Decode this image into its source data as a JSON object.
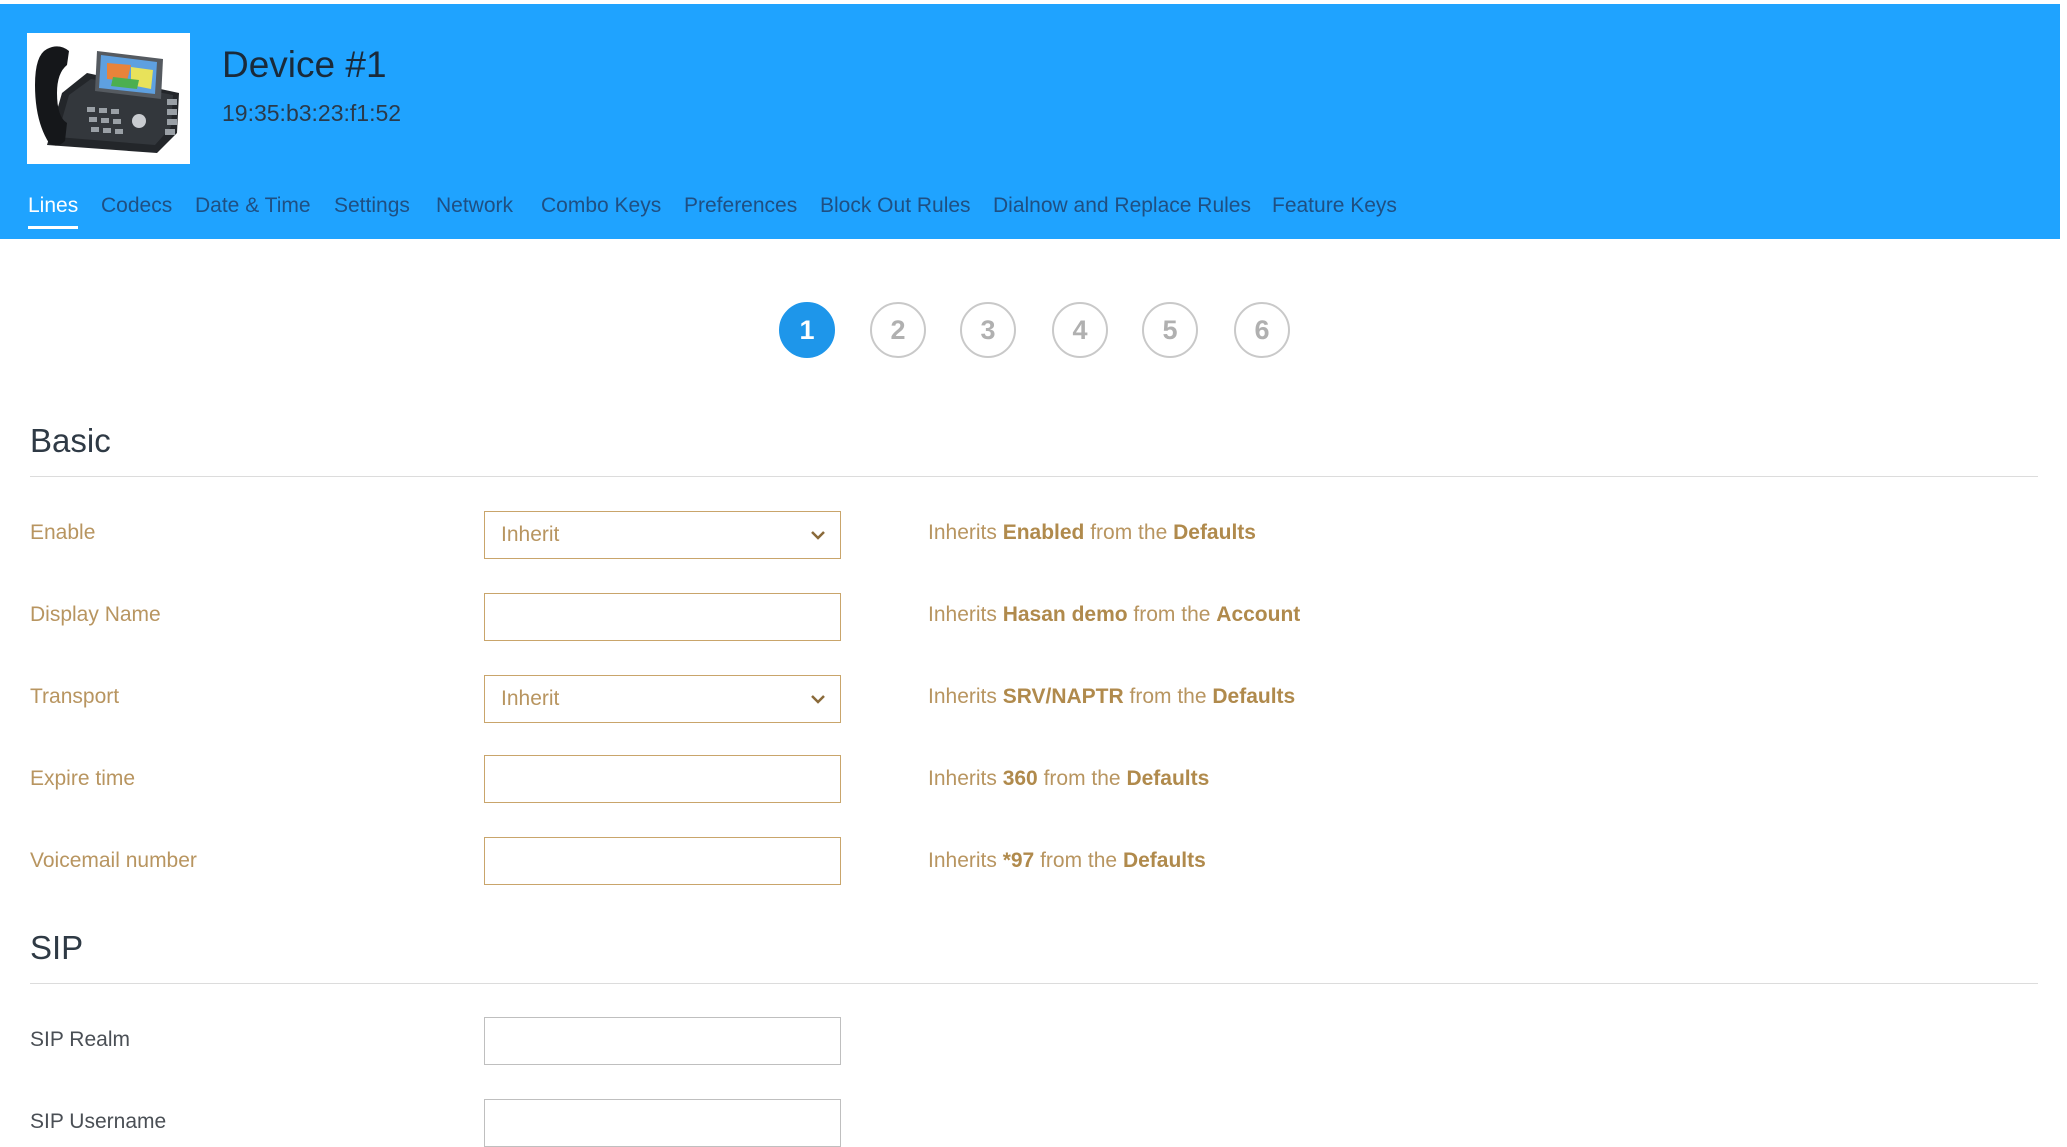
{
  "header": {
    "title": "Device #1",
    "mac": "19:35:b3:23:f1:52",
    "image_icon": "desk-phone-image"
  },
  "tabs": [
    {
      "label": "Lines",
      "active": true
    },
    {
      "label": "Codecs"
    },
    {
      "label": "Date & Time"
    },
    {
      "label": "Settings"
    },
    {
      "label": "Network"
    },
    {
      "label": "Combo Keys"
    },
    {
      "label": "Preferences"
    },
    {
      "label": "Block Out Rules"
    },
    {
      "label": "Dialnow and Replace Rules"
    },
    {
      "label": "Feature Keys"
    }
  ],
  "line_steps": [
    {
      "label": "1",
      "active": true
    },
    {
      "label": "2"
    },
    {
      "label": "3"
    },
    {
      "label": "4"
    },
    {
      "label": "5"
    },
    {
      "label": "6"
    }
  ],
  "basic": {
    "title": "Basic",
    "enable": {
      "label": "Enable",
      "value": "Inherit",
      "hint_pre": "Inherits ",
      "hint_value": "Enabled",
      "hint_mid": " from the ",
      "hint_source": "Defaults"
    },
    "display_name": {
      "label": "Display Name",
      "value": "",
      "hint_pre": "Inherits ",
      "hint_value": "Hasan demo",
      "hint_mid": " from the ",
      "hint_source": "Account"
    },
    "transport": {
      "label": "Transport",
      "value": "Inherit",
      "hint_pre": "Inherits ",
      "hint_value": "SRV/NAPTR",
      "hint_mid": " from the ",
      "hint_source": "Defaults"
    },
    "expire_time": {
      "label": "Expire time",
      "value": "",
      "hint_pre": "Inherits ",
      "hint_value": "360",
      "hint_mid": " from the ",
      "hint_source": "Defaults"
    },
    "voicemail_number": {
      "label": "Voicemail number",
      "value": "",
      "hint_pre": "Inherits ",
      "hint_value": "*97",
      "hint_mid": " from the ",
      "hint_source": "Defaults"
    }
  },
  "sip": {
    "title": "SIP",
    "realm": {
      "label": "SIP Realm",
      "value": ""
    },
    "username": {
      "label": "SIP Username",
      "value": ""
    }
  },
  "colors": {
    "header_bg": "#1fa3ff",
    "accent": "#1e96ea",
    "inherit_text": "#b89560",
    "inherit_border": "#c9a56b"
  }
}
